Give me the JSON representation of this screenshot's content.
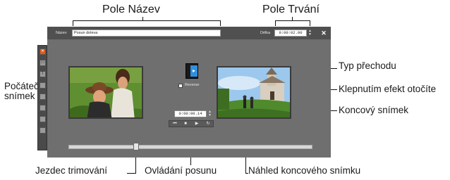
{
  "callouts": {
    "name_field": "Pole Název",
    "duration_field": "Pole Trvání",
    "transition_type": "Typ přechodu",
    "reverse_hint": "Klepnutím efekt otočíte",
    "start_frame": "Počáteční snímek",
    "end_frame": "Koncový snímek",
    "trim_slider": "Jezdec trimování",
    "shuttle_control": "Ovládání posunu",
    "end_frame_preview": "Náhled koncového snímku"
  },
  "editor": {
    "name_label": "Název",
    "name_value": "Posun doleva",
    "duration_label": "Délka",
    "duration_value": "0:00:02.00",
    "reverse_label": "Reverse",
    "timecode_value": "0:00:00.14"
  },
  "colors": {
    "panel": "#6f6f6f",
    "panel_topbar": "#505050",
    "accent_tool": "#e25c1a",
    "transition_blue": "#2f8fe0"
  },
  "icons": {
    "close": "close-icon",
    "transition": "transition-type-icon",
    "transport": [
      "skip-start-icon",
      "stop-icon",
      "play-icon",
      "loop-icon"
    ]
  }
}
